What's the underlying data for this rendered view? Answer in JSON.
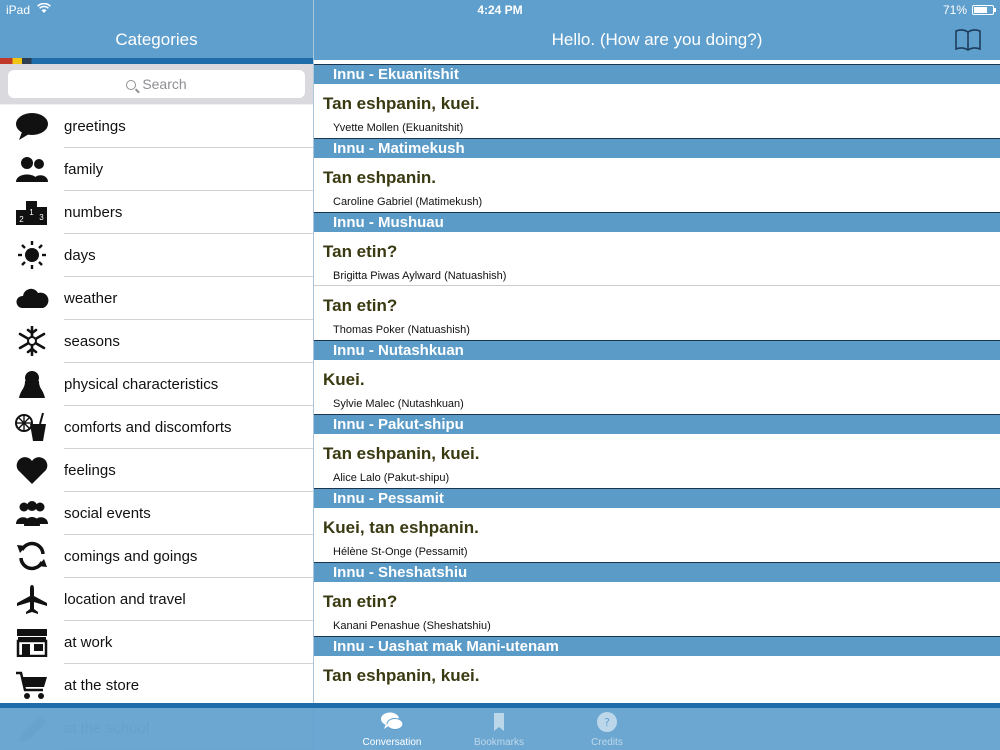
{
  "status": {
    "device": "iPad",
    "time": "4:24 PM",
    "battery": "71%",
    "battery_level": 0.71,
    "icons": [
      "wifi-icon",
      "battery-icon"
    ]
  },
  "left_nav": {
    "title": "Categories"
  },
  "right_nav": {
    "title": "Hello. (How are you doing?)",
    "icon": "book-icon"
  },
  "search": {
    "placeholder": "Search"
  },
  "categories": [
    {
      "label": "greetings",
      "icon": "speech-bubble-icon"
    },
    {
      "label": "family",
      "icon": "people-icon"
    },
    {
      "label": "numbers",
      "icon": "numbers-icon"
    },
    {
      "label": "days",
      "icon": "sun-icon"
    },
    {
      "label": "weather",
      "icon": "cloud-icon"
    },
    {
      "label": "seasons",
      "icon": "snowflake-icon"
    },
    {
      "label": "physical characteristics",
      "icon": "person-silhouette-icon"
    },
    {
      "label": "comforts and discomforts",
      "icon": "drink-icon"
    },
    {
      "label": "feelings",
      "icon": "heart-icon"
    },
    {
      "label": "social events",
      "icon": "group-icon"
    },
    {
      "label": "comings and goings",
      "icon": "refresh-icon"
    },
    {
      "label": "location and travel",
      "icon": "airplane-icon"
    },
    {
      "label": "at work",
      "icon": "store-icon"
    },
    {
      "label": "at the store",
      "icon": "cart-icon"
    },
    {
      "label": "at the school",
      "icon": "pencil-icon"
    }
  ],
  "groups": [
    {
      "dialect": "Innu - Ekuanitshit",
      "entries": [
        {
          "phrase": "Tan eshpanin, kuei.",
          "speaker": "Yvette Mollen (Ekuanitshit)"
        }
      ]
    },
    {
      "dialect": "Innu - Matimekush",
      "entries": [
        {
          "phrase": "Tan eshpanin.",
          "speaker": "Caroline Gabriel (Matimekush)"
        }
      ]
    },
    {
      "dialect": "Innu - Mushuau",
      "entries": [
        {
          "phrase": "Tan etin?",
          "speaker": "Brigitta Piwas Aylward (Natuashish)"
        },
        {
          "phrase": "Tan etin?",
          "speaker": "Thomas Poker (Natuashish)"
        }
      ]
    },
    {
      "dialect": "Innu - Nutashkuan",
      "entries": [
        {
          "phrase": "Kuei.",
          "speaker": "Sylvie Malec (Nutashkuan)"
        }
      ]
    },
    {
      "dialect": "Innu - Pakut-shipu",
      "entries": [
        {
          "phrase": "Tan eshpanin, kuei.",
          "speaker": "Alice Lalo (Pakut-shipu)"
        }
      ]
    },
    {
      "dialect": "Innu - Pessamit",
      "entries": [
        {
          "phrase": "Kuei, tan eshpanin.",
          "speaker": "Hélène St-Onge (Pessamit)"
        }
      ]
    },
    {
      "dialect": "Innu - Sheshatshiu",
      "entries": [
        {
          "phrase": "Tan etin?",
          "speaker": "Kanani Penashue (Sheshatshiu)"
        }
      ]
    },
    {
      "dialect": "Innu - Uashat mak Mani-utenam",
      "entries": [
        {
          "phrase": "Tan eshpanin, kuei.",
          "speaker": ""
        }
      ]
    }
  ],
  "tabbar": {
    "tabs": [
      {
        "label": "Conversation",
        "icon": "conversation-icon",
        "active": true
      },
      {
        "label": "Bookmarks",
        "icon": "bookmarks-icon",
        "active": false
      },
      {
        "label": "Credits",
        "icon": "credits-icon",
        "active": false
      }
    ]
  },
  "colors": {
    "nav": "#5f9fcd",
    "group_header": "#5b9bc8",
    "phrase": "#3a3a12"
  }
}
